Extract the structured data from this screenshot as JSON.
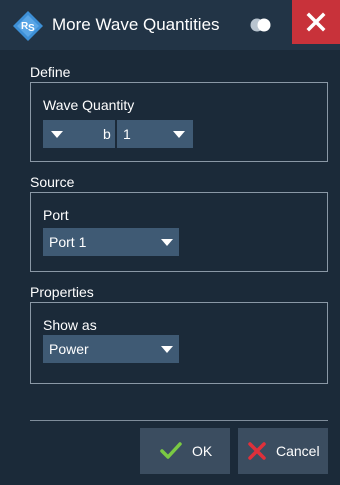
{
  "window": {
    "title": "More Wave Quantities",
    "close_icon": "close-icon",
    "logo_icon": "rs-logo-icon",
    "toggle_icon": "transparency-toggle-icon"
  },
  "define": {
    "section_label": "Define",
    "wave_quantity_label": "Wave Quantity",
    "wave_combo_value": "b",
    "index_combo_value": "1"
  },
  "source": {
    "section_label": "Source",
    "port_label": "Port",
    "port_value": "Port 1"
  },
  "properties": {
    "section_label": "Properties",
    "show_as_label": "Show as",
    "show_as_value": "Power"
  },
  "buttons": {
    "ok_label": "OK",
    "cancel_label": "Cancel"
  },
  "colors": {
    "background": "#1b2a39",
    "titlebar": "#223446",
    "close": "#c8323a",
    "combo": "#3f5a74",
    "button": "#3b4d60",
    "ok_check": "#7ac943",
    "cancel_x": "#e0303a"
  }
}
